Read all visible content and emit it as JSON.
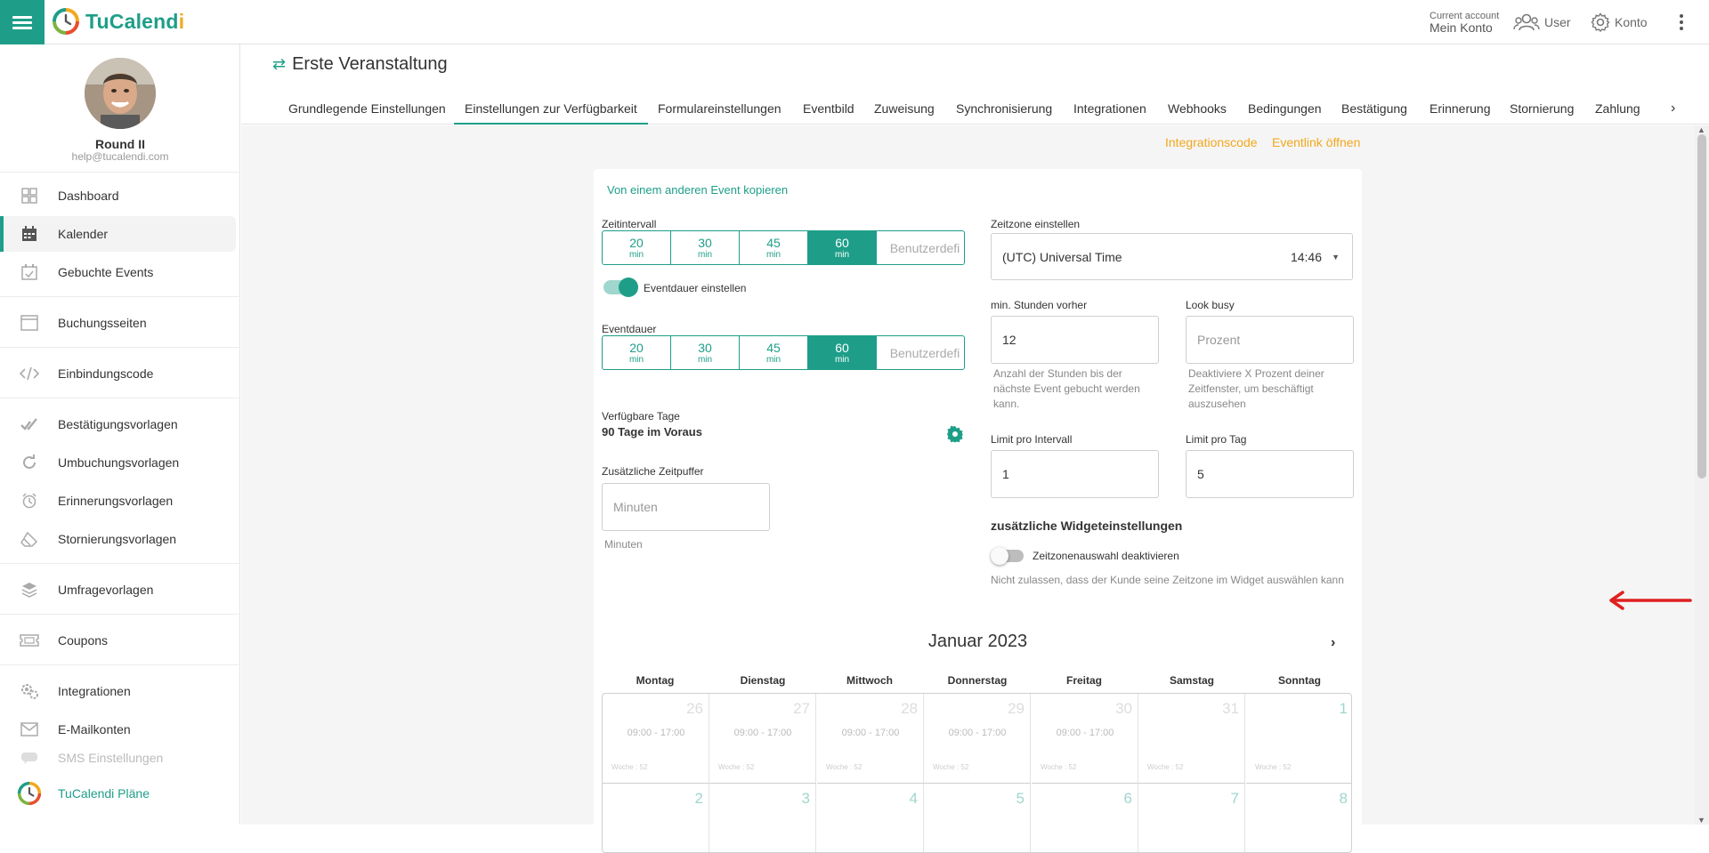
{
  "header": {
    "logo_part1": "TuCalend",
    "logo_part2": "i",
    "account_label": "Current account",
    "account_name": "Mein Konto",
    "user_label": "User",
    "konto_label": "Konto"
  },
  "profile": {
    "name": "Round II",
    "email": "help@tucalendi.com"
  },
  "sidebar": {
    "items": [
      {
        "label": "Dashboard",
        "icon": "grid-icon"
      },
      {
        "label": "Kalender",
        "icon": "calendar-icon"
      },
      {
        "label": "Gebuchte Events",
        "icon": "calendar-check-icon"
      },
      {
        "label": "Buchungsseiten",
        "icon": "browser-window-icon"
      },
      {
        "label": "Einbindungscode",
        "icon": "code-icon"
      },
      {
        "label": "Bestätigungsvorlagen",
        "icon": "double-check-icon"
      },
      {
        "label": "Umbuchungsvorlagen",
        "icon": "redo-icon"
      },
      {
        "label": "Erinnerungsvorlagen",
        "icon": "alarm-clock-icon"
      },
      {
        "label": "Stornierungsvorlagen",
        "icon": "eraser-icon"
      },
      {
        "label": "Umfragevorlagen",
        "icon": "layers-icon"
      },
      {
        "label": "Coupons",
        "icon": "ticket-icon"
      },
      {
        "label": "Integrationen",
        "icon": "gears-icon"
      },
      {
        "label": "E-Mailkonten",
        "icon": "envelope-icon"
      },
      {
        "label": "SMS Einstellungen",
        "icon": "sms-icon"
      },
      {
        "label": "TuCalendi Pläne",
        "icon": "tucalendi-logo-icon"
      }
    ]
  },
  "page": {
    "title": "Erste Veranstaltung",
    "tabs": [
      "Grundlegende Einstellungen",
      "Einstellungen zur Verfügbarkeit",
      "Formulareinstellungen",
      "Eventbild",
      "Zuweisung",
      "Synchronisierung",
      "Integrationen",
      "Webhooks",
      "Bedingungen",
      "Bestätigung",
      "Erinnerung",
      "Stornierung",
      "Zahlung"
    ],
    "active_tab": "Einstellungen zur Verfügbarkeit",
    "integrationscode_link": "Integrationscode",
    "eventlink_link": "Eventlink öffnen"
  },
  "form": {
    "copy_link": "Von einem anderen Event kopieren",
    "zeitintervall": {
      "label": "Zeitintervall",
      "options": [
        "20",
        "30",
        "45",
        "60"
      ],
      "unit": "min",
      "selected": "60",
      "custom_placeholder": "Benutzerdefi"
    },
    "eventdauer_toggle": {
      "label": "Eventdauer einstellen",
      "on": true
    },
    "eventdauer": {
      "label": "Eventdauer",
      "options": [
        "20",
        "30",
        "45",
        "60"
      ],
      "unit": "min",
      "selected": "60",
      "custom_placeholder": "Benutzerdefi"
    },
    "verfuegbare_tage": {
      "label": "Verfügbare Tage",
      "value": "90 Tage im Voraus"
    },
    "zeitpuffer": {
      "label": "Zusätzliche Zeitpuffer",
      "placeholder": "Minuten",
      "help": "Minuten"
    },
    "zeitzone": {
      "label": "Zeitzone einstellen",
      "value": "(UTC) Universal Time",
      "time": "14:46"
    },
    "min_stunden": {
      "label": "min. Stunden vorher",
      "value": "12",
      "help": "Anzahl der Stunden bis der nächste Event gebucht werden kann."
    },
    "look_busy": {
      "label": "Look busy",
      "placeholder": "Prozent",
      "help": "Deaktiviere X Prozent deiner Zeitfenster, um beschäftigt auszusehen"
    },
    "limit_intervall": {
      "label": "Limit pro Intervall",
      "value": "1"
    },
    "limit_tag": {
      "label": "Limit pro Tag",
      "value": "5"
    },
    "widget": {
      "heading": "zusätzliche Widgeteinstellungen",
      "toggle_label": "Zeitzonenauswahl deaktivieren",
      "toggle_on": false,
      "help": "Nicht zulassen, dass der Kunde seine Zeitzone im Widget auswählen kann"
    }
  },
  "calendar": {
    "month": "Januar 2023",
    "weekdays": [
      "Montag",
      "Dienstag",
      "Mittwoch",
      "Donnerstag",
      "Freitag",
      "Samstag",
      "Sonntag"
    ],
    "week1": {
      "days": [
        "26",
        "27",
        "28",
        "29",
        "30",
        "31",
        "1"
      ],
      "times": [
        "09:00 - 17:00",
        "09:00 - 17:00",
        "09:00 - 17:00",
        "09:00 - 17:00",
        "09:00 - 17:00",
        "",
        ""
      ],
      "week_label": "Woche : 52"
    },
    "week2": {
      "days": [
        "2",
        "3",
        "4",
        "5",
        "6",
        "7",
        "8"
      ]
    }
  },
  "colors": {
    "accent": "#1e9e88",
    "link_orange": "#f2a81d",
    "arrow_red": "#e02020"
  }
}
